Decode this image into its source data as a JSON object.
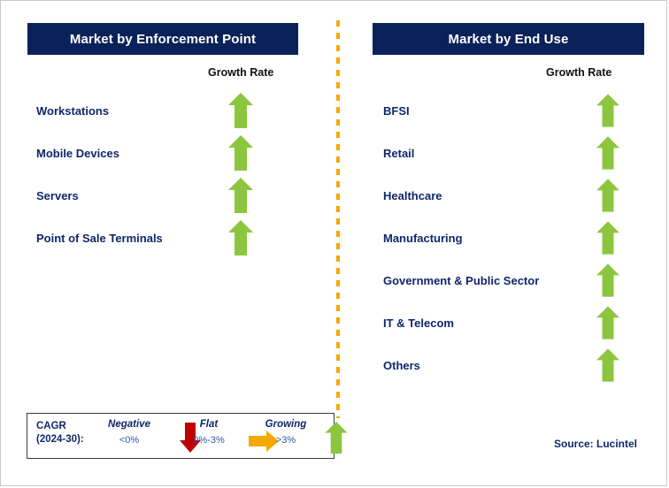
{
  "panels": [
    {
      "id": "enforcement-point",
      "title": "Market by Enforcement Point",
      "growth_rate_label": "Growth Rate",
      "rows": [
        {
          "label": "Workstations",
          "trend": "growing",
          "icon": "arrow-up-icon"
        },
        {
          "label": "Mobile Devices",
          "trend": "growing",
          "icon": "arrow-up-icon"
        },
        {
          "label": "Servers",
          "trend": "growing",
          "icon": "arrow-up-icon"
        },
        {
          "label": "Point of Sale Terminals",
          "trend": "growing",
          "icon": "arrow-up-icon"
        }
      ]
    },
    {
      "id": "end-use",
      "title": "Market by End Use",
      "growth_rate_label": "Growth Rate",
      "rows": [
        {
          "label": "BFSI",
          "trend": "growing",
          "icon": "arrow-up-icon"
        },
        {
          "label": "Retail",
          "trend": "growing",
          "icon": "arrow-up-icon"
        },
        {
          "label": "Healthcare",
          "trend": "growing",
          "icon": "arrow-up-icon"
        },
        {
          "label": "Manufacturing",
          "trend": "growing",
          "icon": "arrow-up-icon"
        },
        {
          "label": "Government & Public Sector",
          "trend": "growing",
          "icon": "arrow-up-icon"
        },
        {
          "label": "IT & Telecom",
          "trend": "growing",
          "icon": "arrow-up-icon"
        },
        {
          "label": "Others",
          "trend": "growing",
          "icon": "arrow-up-icon"
        }
      ]
    }
  ],
  "legend": {
    "title_line1": "CAGR",
    "title_line2": "(2024-30):",
    "items": [
      {
        "word": "Negative",
        "range": "<0%",
        "icon": "arrow-down-icon",
        "color": "#c00000"
      },
      {
        "word": "Flat",
        "range": "0%-3%",
        "icon": "arrow-right-icon",
        "color": "#f5a800"
      },
      {
        "word": "Growing",
        "range": ">3%",
        "icon": "arrow-up-icon",
        "color": "#8cc63e"
      }
    ]
  },
  "source": "Source: Lucintel",
  "colors": {
    "header_navy": "#0a2259",
    "label_navy": "#10266b",
    "growing_green": "#8cc63e",
    "negative_red": "#c00000",
    "flat_orange": "#f5a800",
    "divider_orange": "#f5a800",
    "page_background": "#ffffff"
  }
}
